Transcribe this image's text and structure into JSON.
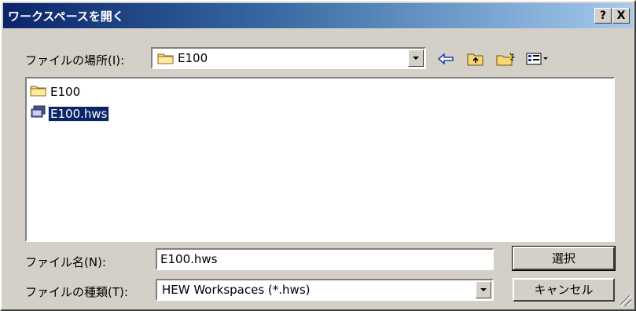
{
  "window": {
    "title": "ワークスペースを開く",
    "help_button": "?",
    "close_button": "X"
  },
  "location": {
    "label": "ファイルの場所(I):",
    "value": "E100"
  },
  "toolbar": {
    "icons": [
      "back-arrow-icon",
      "up-folder-icon",
      "new-folder-icon",
      "view-menu-icon"
    ]
  },
  "files": [
    {
      "name": "E100",
      "icon": "folder-icon",
      "selected": false
    },
    {
      "name": "E100.hws",
      "icon": "workspace-file-icon",
      "selected": true
    }
  ],
  "filename": {
    "label": "ファイル名(N):",
    "value": "E100.hws"
  },
  "filetype": {
    "label": "ファイルの種類(T):",
    "value": "HEW Workspaces (*.hws)"
  },
  "buttons": {
    "select": "選択",
    "cancel": "キャンセル"
  },
  "colors": {
    "title_gradient_start": "#0a246a",
    "title_gradient_end": "#a6caf0",
    "selection": "#0a246a",
    "face": "#d4d0c8"
  }
}
